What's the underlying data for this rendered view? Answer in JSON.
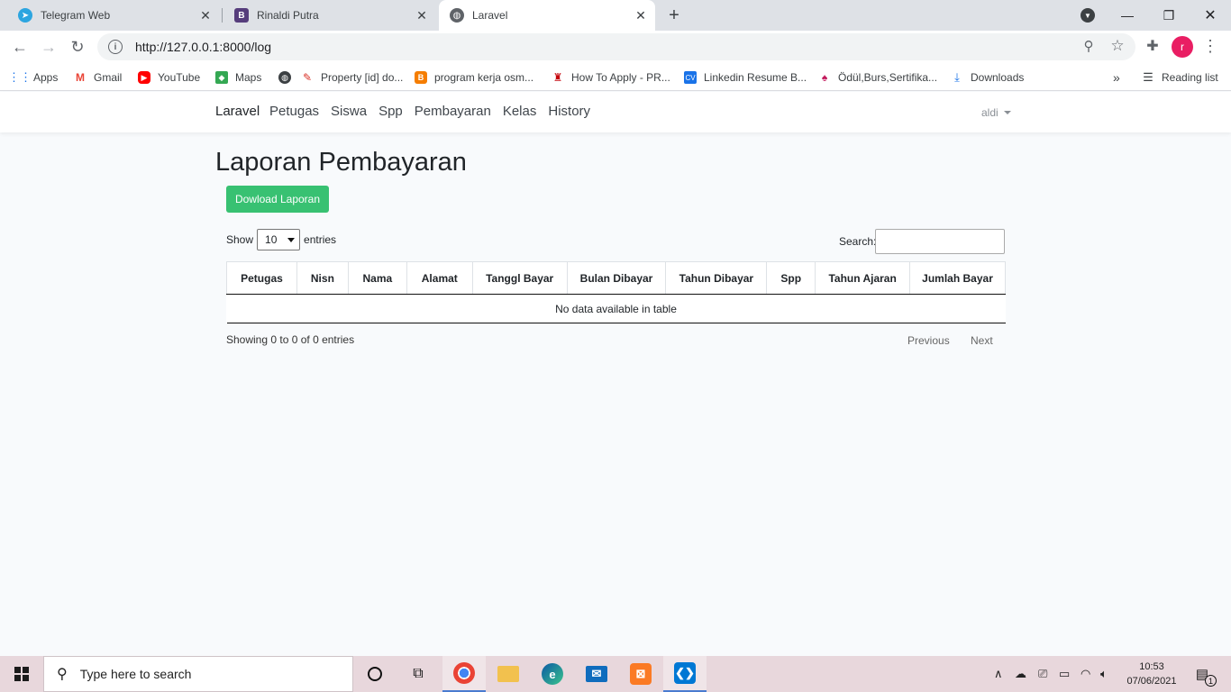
{
  "browser": {
    "tabs": [
      {
        "title": "Telegram Web",
        "icon": "telegram-icon",
        "active": false
      },
      {
        "title": "Rinaldi Putra",
        "icon": "bootstrap-icon",
        "active": false
      },
      {
        "title": "Laravel",
        "icon": "globe-icon",
        "active": true
      }
    ],
    "new_tab": "+",
    "url": "http://127.0.0.1:8000/log",
    "profile_initial": "r",
    "bookmarks": [
      {
        "label": "Apps",
        "icon": "apps-grid-icon"
      },
      {
        "label": "Gmail",
        "icon": "gmail-icon"
      },
      {
        "label": "YouTube",
        "icon": "youtube-icon"
      },
      {
        "label": "Maps",
        "icon": "maps-icon"
      },
      {
        "label": "",
        "icon": "globe-icon"
      },
      {
        "label": "Property [id] do...",
        "icon": "bookmark-icon"
      },
      {
        "label": "program kerja osm...",
        "icon": "blogger-icon"
      },
      {
        "label": "How To Apply - PR...",
        "icon": "university-icon"
      },
      {
        "label": "Linkedin Resume B...",
        "icon": "cv-icon"
      },
      {
        "label": "Ödül,Burs,Sertifika...",
        "icon": "tulip-icon"
      },
      {
        "label": "Downloads",
        "icon": "download-icon"
      }
    ],
    "more_bookmarks": "»",
    "reading_list": "Reading list"
  },
  "navbar": {
    "brand": "Laravel",
    "links": [
      "Petugas",
      "Siswa",
      "Spp",
      "Pembayaran",
      "Kelas",
      "History"
    ],
    "user": "aldi"
  },
  "page": {
    "title": "Laporan Pembayaran",
    "download_button": "Dowload Laporan",
    "show_label": "Show",
    "entries_value": "10",
    "entries_label": "entries",
    "search_label": "Search:",
    "search_value": "",
    "table": {
      "columns": [
        "Petugas",
        "Nisn",
        "Nama",
        "Alamat",
        "Tanggl Bayar",
        "Bulan Dibayar",
        "Tahun Dibayar",
        "Spp",
        "Tahun Ajaran",
        "Jumlah Bayar"
      ],
      "empty_message": "No data available in table"
    },
    "info": "Showing 0 to 0 of 0 entries",
    "pagination": {
      "previous": "Previous",
      "next": "Next"
    }
  },
  "taskbar": {
    "search_placeholder": "Type here to search",
    "apps": [
      "cortana-icon",
      "task-view-icon",
      "chrome-icon",
      "file-explorer-icon",
      "edge-icon",
      "mail-icon",
      "xampp-icon",
      "vscode-icon"
    ],
    "time": "10:53",
    "date": "07/06/2021",
    "notification_count": "1"
  },
  "colors": {
    "accent_green": "#38c172",
    "taskbar_bg": "#e8d7dc",
    "tab_strip": "#dee1e6"
  }
}
